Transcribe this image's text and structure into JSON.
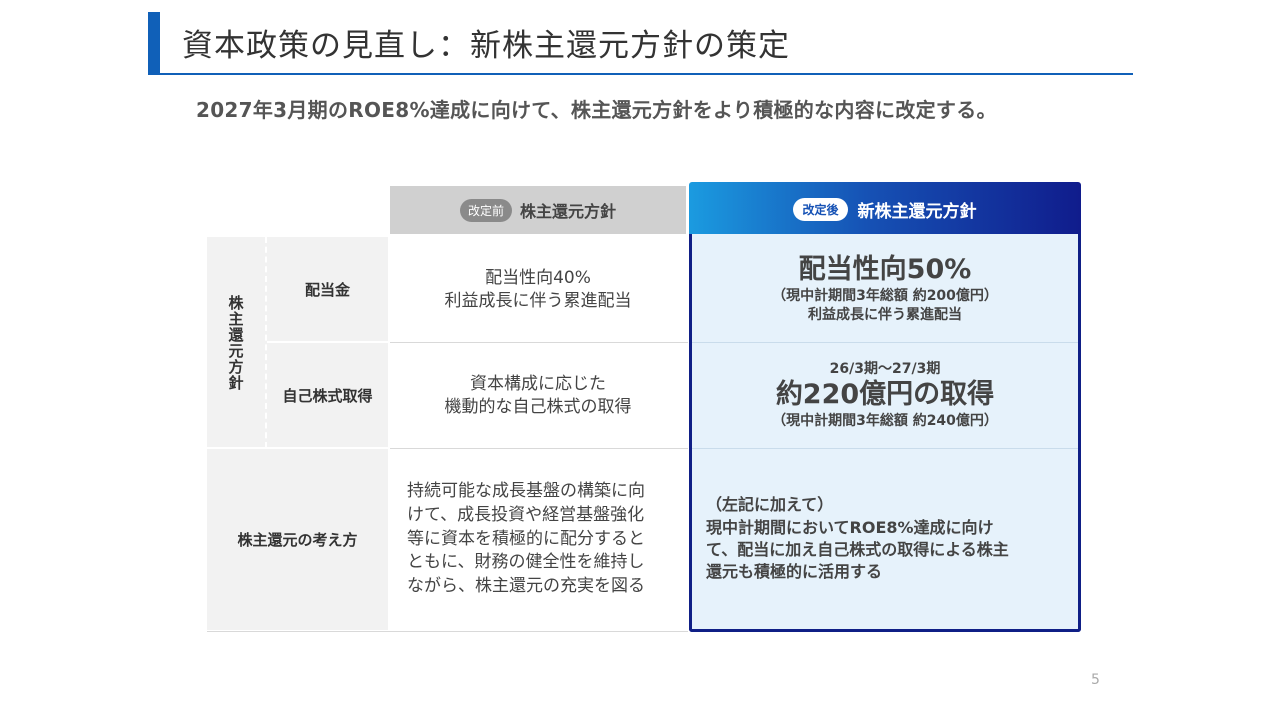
{
  "title": "資本政策の見直し：新株主還元方針の策定",
  "subtitle": "2027年3月期のROE8%達成に向けて、株主還元方針をより積極的な内容に改定する。",
  "table": {
    "group_label": "株主還元方針",
    "header_before": {
      "badge": "改定前",
      "label": "株主還元方針"
    },
    "header_after": {
      "badge": "改定後",
      "label": "新株主還元方針"
    },
    "rows": [
      {
        "label": "配当金",
        "before": [
          "配当性向40%",
          "利益成長に伴う累進配当"
        ],
        "after_main": "配当性向50%",
        "after_sub": [
          "（現中計期間3年総額 約200億円）",
          "利益成長に伴う累進配当"
        ]
      },
      {
        "label": "自己株式取得",
        "before": [
          "資本構成に応じた",
          "機動的な自己株式の取得"
        ],
        "after_pre": "26/3期～27/3期",
        "after_main": "約220億円の取得",
        "after_sub": [
          "（現中計期間3年総額 約240億円）"
        ]
      },
      {
        "label": "株主還元の考え方",
        "before": [
          "持続可能な成長基盤の構築に向",
          "けて、成長投資や経営基盤強化",
          "等に資本を積極的に配分すると",
          "ともに、財務の健全性を維持し",
          "ながら、株主還元の充実を図る"
        ],
        "after": [
          "（左記に加えて）",
          "現中計期間においてROE8%達成に向け",
          "て、配当に加え自己株式の取得による株主",
          "還元も積極的に活用する"
        ]
      }
    ]
  },
  "page_number": "5",
  "colors": {
    "accent": "#1060b8",
    "panel_border": "#0f1f86",
    "panel_bg": "#e6f2fb"
  }
}
